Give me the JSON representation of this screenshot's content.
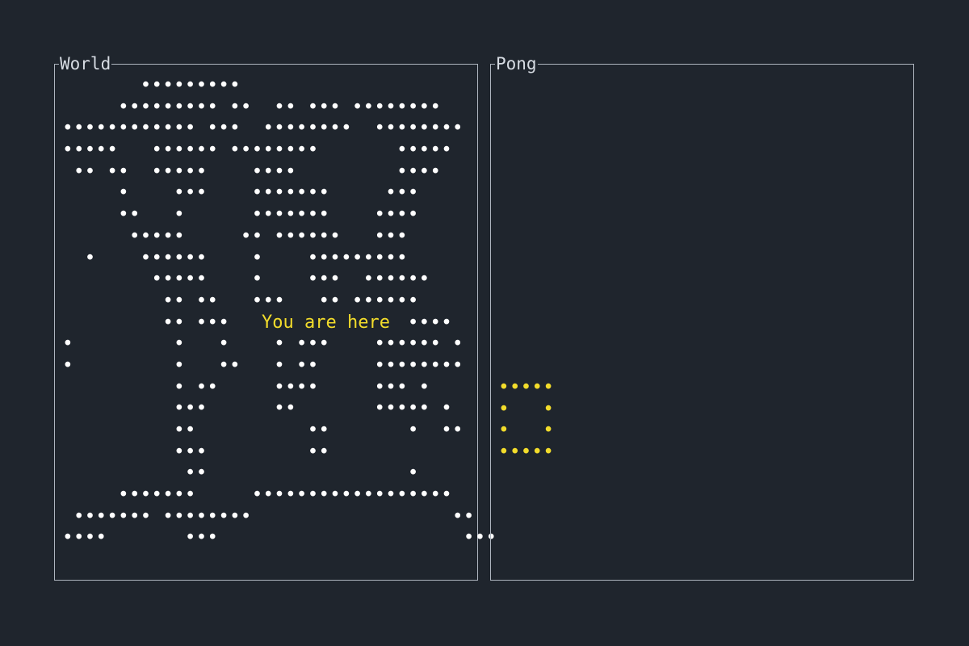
{
  "world": {
    "title": "World",
    "marker_label": "You are here",
    "map_rows": [
      "       ••••••••• ",
      "     ••••••••• ••  •• ••• •••••••• ",
      "•••••••••••• •••  ••••••••  ••••••••",
      "•••••   •••••• ••••••••       •••••",
      " •• ••  •••••    ••••         ••••",
      "     •    •••    •••••••     •••",
      "     ••   •      •••••••    ••••",
      "      •••••     •• ••••••   •••",
      "  •    ••••••    •    •••••••••",
      "        •••••    •    •••  ••••••",
      "         •• ••   •••   •• ••••••",
      "         •• •••   ",
      "•         •   •    • •••    •••••• •",
      "•         •   ••   • ••     ••••••••",
      "          • ••     ••••     ••• •",
      "          •••      ••       ••••• •",
      "          ••          ••       •  ••",
      "          •••         ••",
      "           ••                  •",
      "     •••••••     ••••••••••••••••••",
      " ••••••• ••••••••                  ••",
      "••••       •••                      •••"
    ],
    "marker_suffix": "••••"
  },
  "pong": {
    "title": "Pong",
    "shape_rows": [
      "•••••",
      "•   •",
      "•   •",
      "•••••"
    ]
  },
  "colors": {
    "background": "#1f252d",
    "border": "#aeb5bf",
    "title": "#d7dce3",
    "map_dots": "#ffffff",
    "highlight": "#f2dc2b"
  }
}
